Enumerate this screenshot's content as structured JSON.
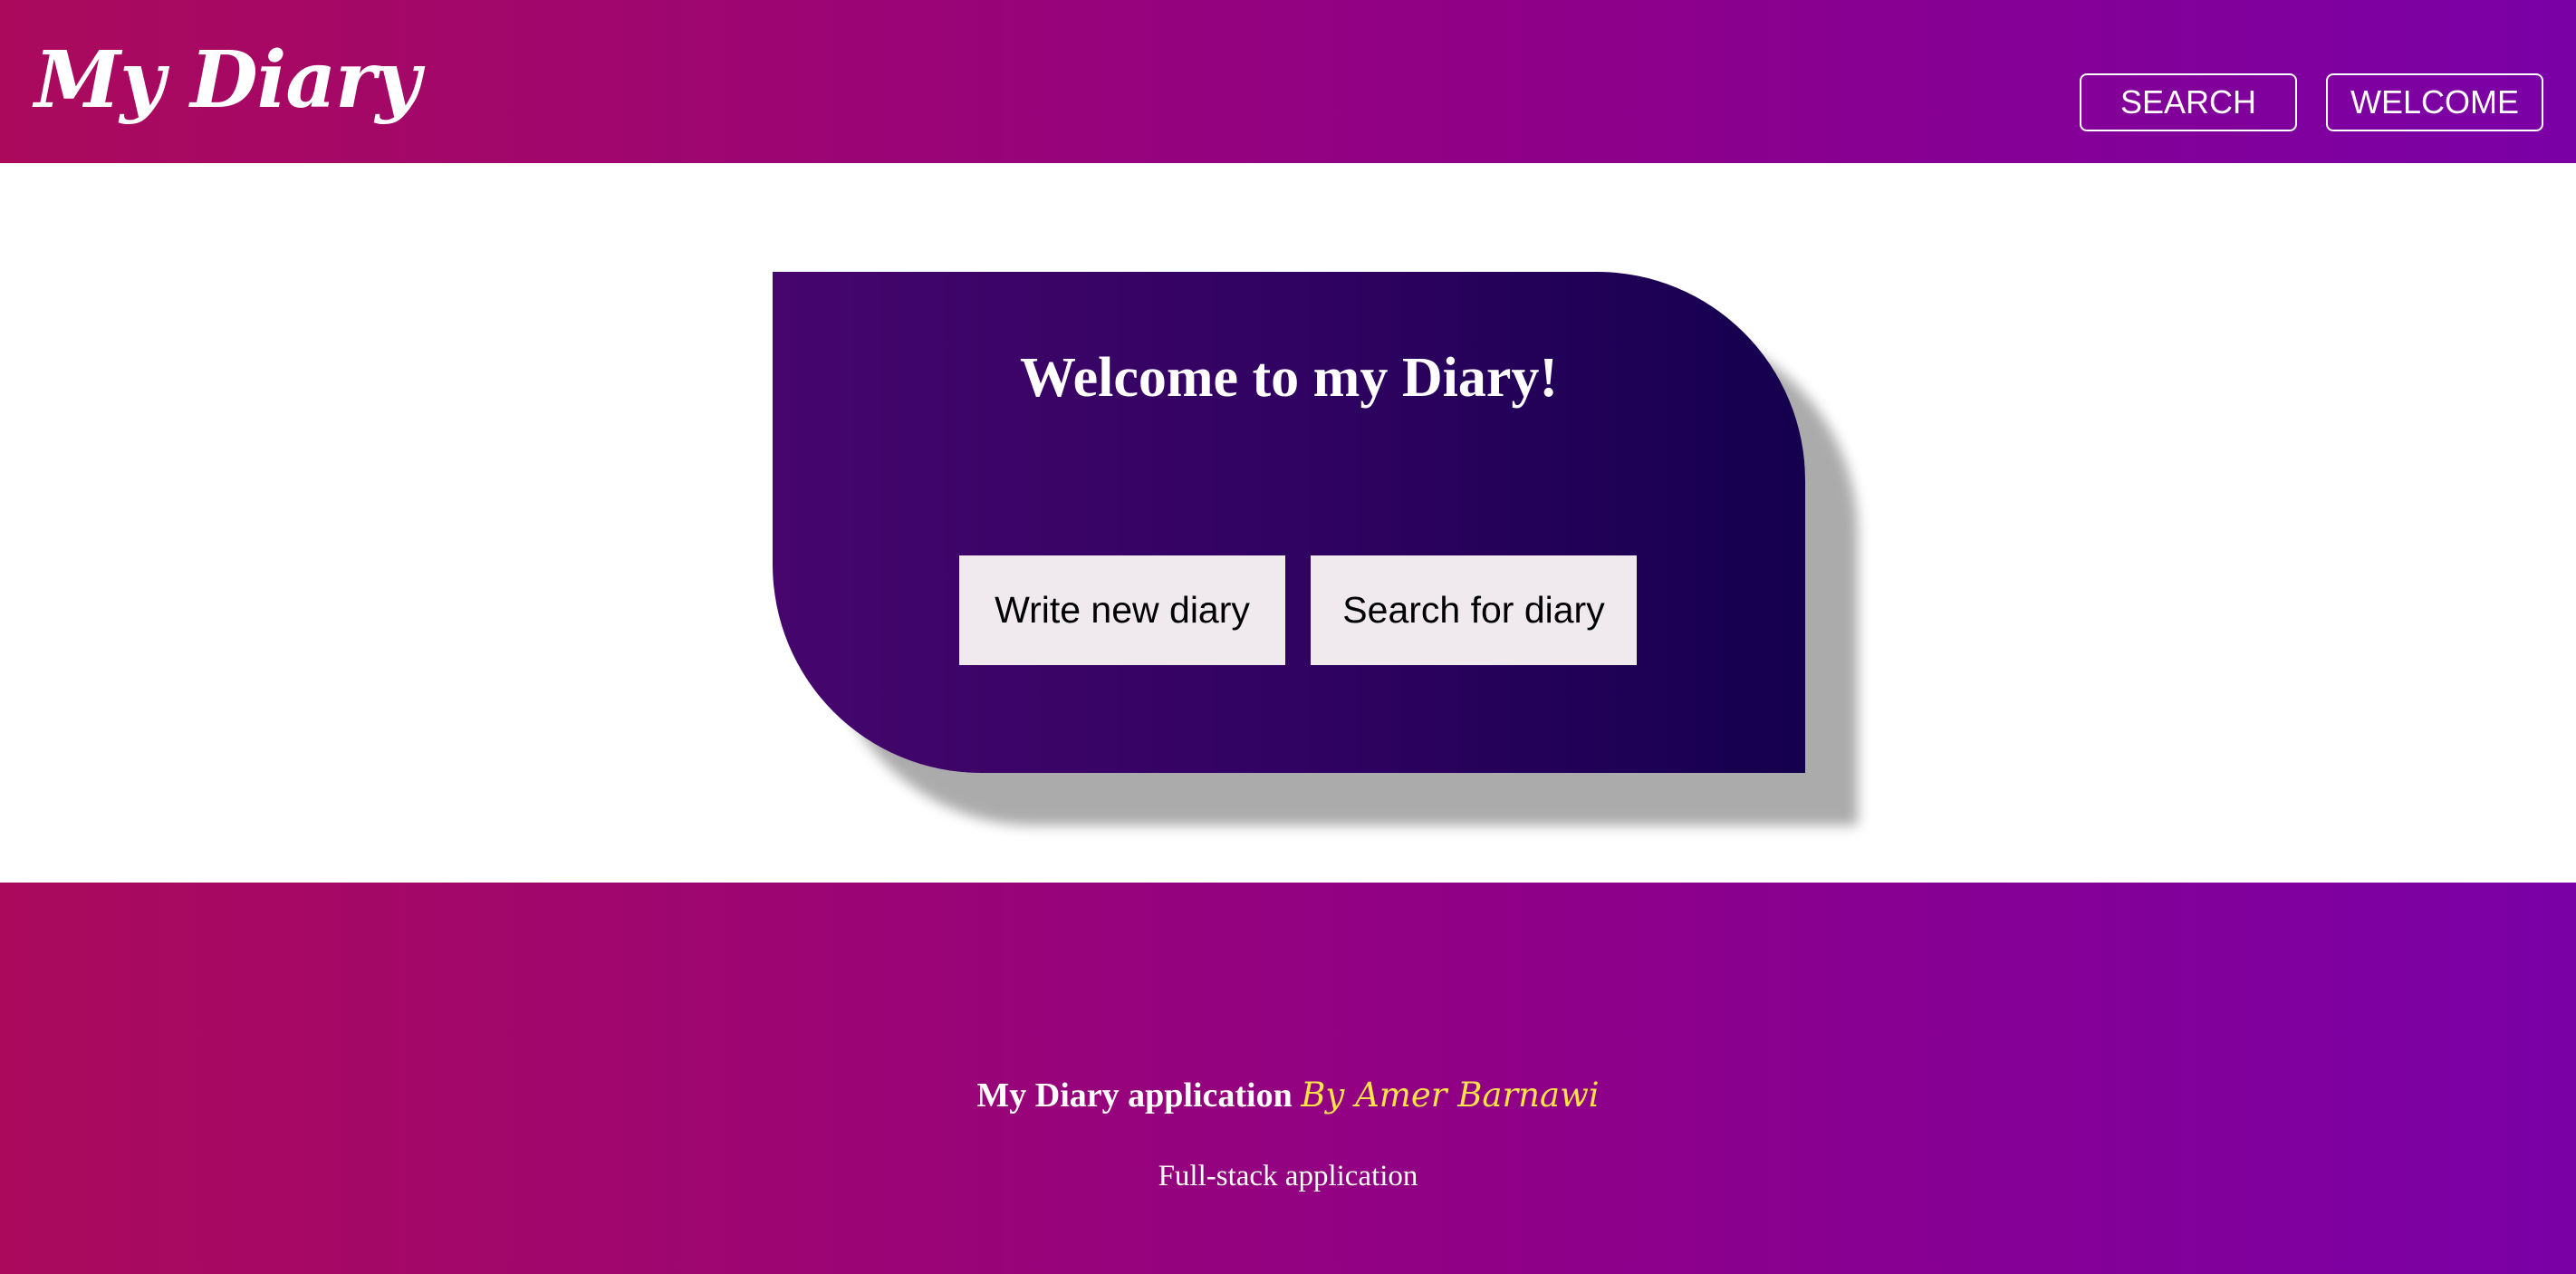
{
  "header": {
    "brand": "My Diary",
    "nav": {
      "search_label": "SEARCH",
      "welcome_label": "WELCOME"
    }
  },
  "welcome_card": {
    "title": "Welcome to my Diary!",
    "write_button_label": "Write new diary",
    "search_button_label": "Search for diary"
  },
  "footer": {
    "app_name": "My Diary application",
    "author": "By Amer Barnawi",
    "subtitle": "Full-stack application"
  },
  "colors": {
    "header_gradient_start": "#ab0a5c",
    "header_gradient_end": "#7a00a6",
    "card_gradient_start": "#46066d",
    "card_gradient_end": "#14004e",
    "card_button_bg": "#f0eaef",
    "author_accent": "#ffe14a"
  }
}
